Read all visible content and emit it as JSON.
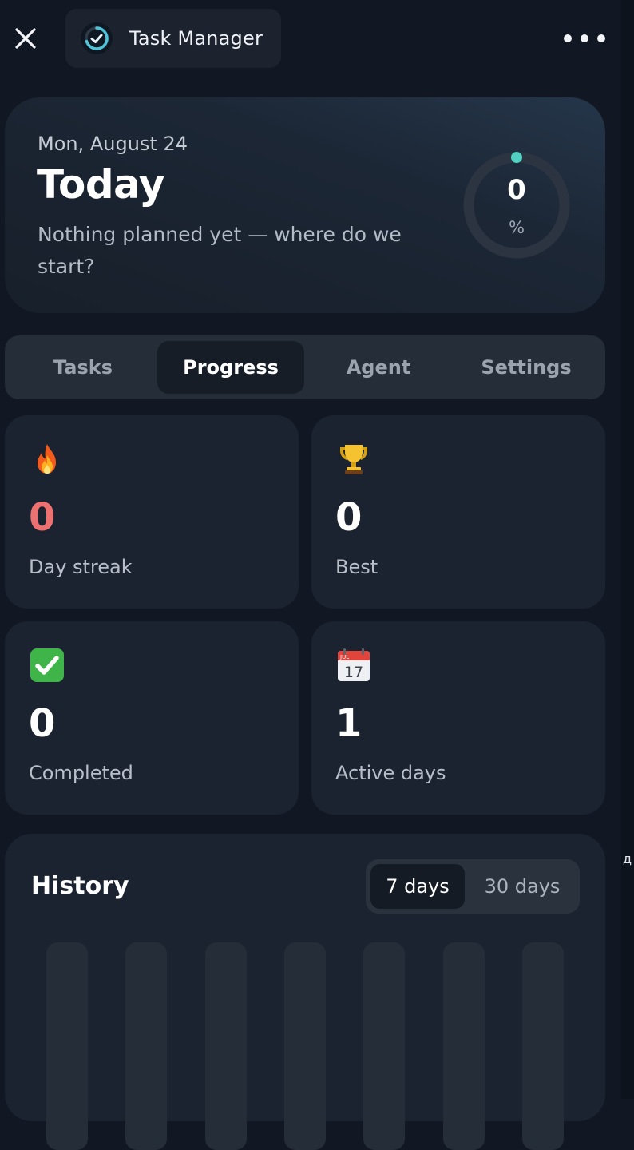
{
  "header": {
    "app_title": "Task Manager",
    "close_icon": "close-icon",
    "more_icon": "more-horizontal-icon",
    "logo_icon": "progress-check-logo-icon"
  },
  "hero": {
    "date": "Mon, August 24",
    "title": "Today",
    "subtitle": "Nothing planned yet — where do we start?",
    "progress_value": "0",
    "progress_unit": "%",
    "progress_percent": 0,
    "accent_color": "#52d1c2"
  },
  "tabs": [
    {
      "label": "Tasks",
      "active": false
    },
    {
      "label": "Progress",
      "active": true
    },
    {
      "label": "Agent",
      "active": false
    },
    {
      "label": "Settings",
      "active": false
    }
  ],
  "stats": [
    {
      "icon": "fire-icon",
      "value": "0",
      "label": "Day streak",
      "value_color": "#ee7171"
    },
    {
      "icon": "trophy-icon",
      "value": "0",
      "label": "Best"
    },
    {
      "icon": "check-mark-icon",
      "value": "0",
      "label": "Completed"
    },
    {
      "icon": "calendar-icon",
      "value": "1",
      "label": "Active days",
      "calendar_month": "JUL",
      "calendar_day": "17"
    }
  ],
  "history": {
    "title": "History",
    "ranges": [
      {
        "label": "7 days",
        "active": true
      },
      {
        "label": "30 days",
        "active": false
      }
    ]
  },
  "edge_glyph": "д"
}
